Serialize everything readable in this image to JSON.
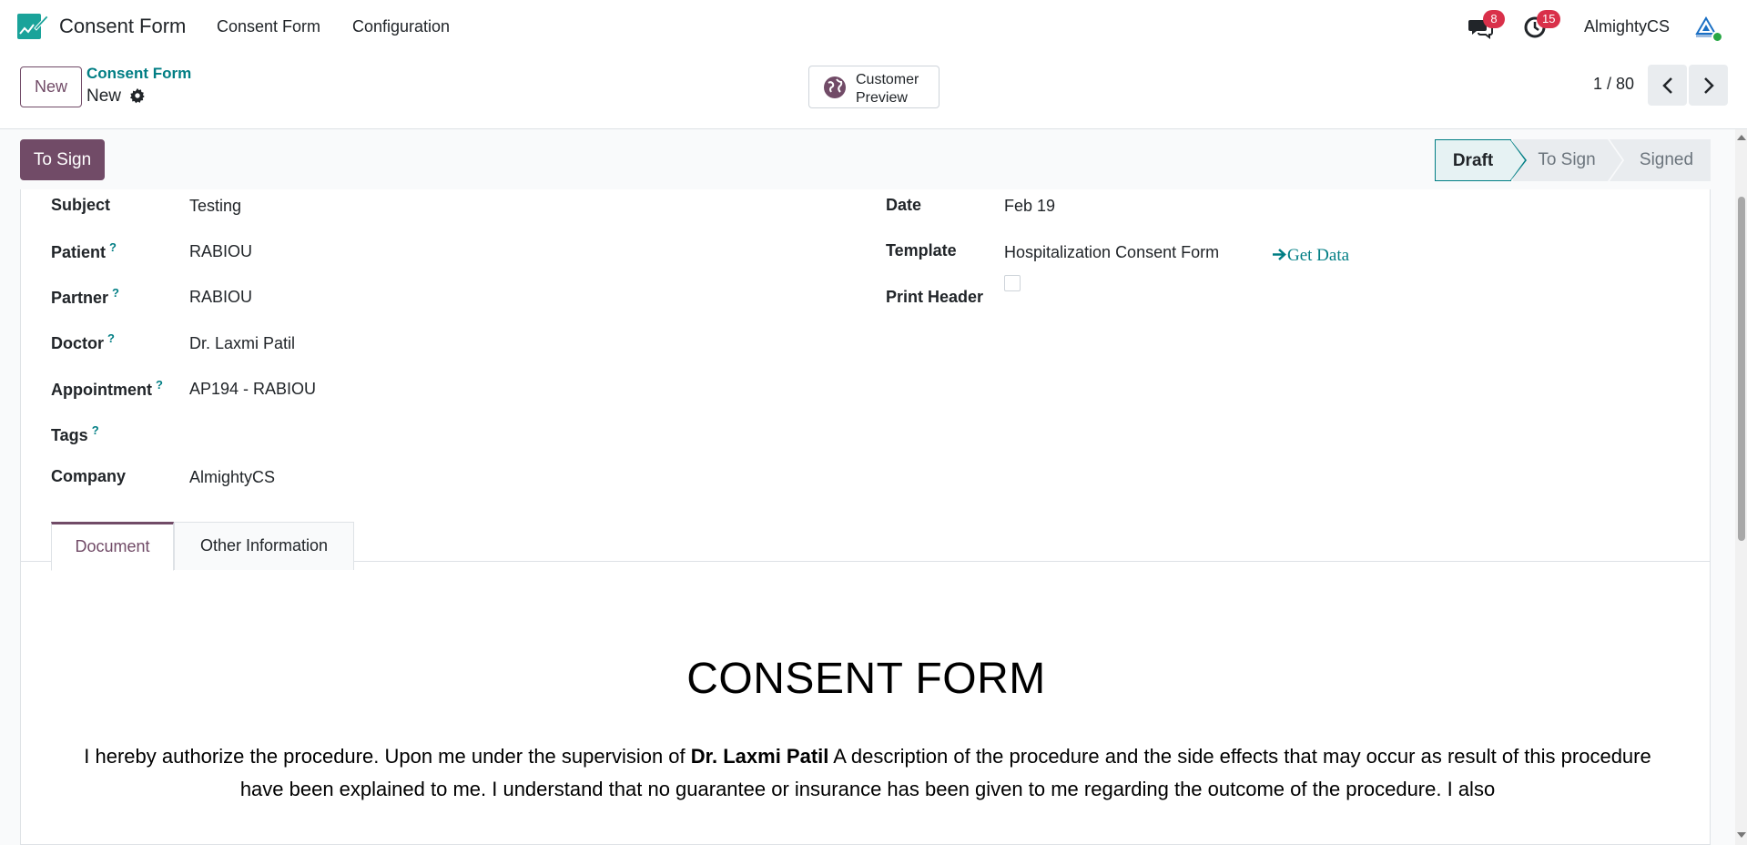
{
  "navbar": {
    "app_title": "Consent Form",
    "menu": [
      "Consent Form",
      "Configuration"
    ],
    "messages_count": "8",
    "activities_count": "15",
    "user_name": "AlmightyCS"
  },
  "control": {
    "new_label": "New",
    "breadcrumb_parent": "Consent Form",
    "breadcrumb_current": "New",
    "customer_preview_label": "Customer Preview",
    "pager": "1 / 80"
  },
  "statusbar": {
    "action_button": "To Sign",
    "stages": [
      "Draft",
      "To Sign",
      "Signed"
    ],
    "active_stage": "Draft"
  },
  "form": {
    "left": [
      {
        "label": "Subject",
        "value": "Testing",
        "help": ""
      },
      {
        "label": "Patient",
        "value": "RABIOU",
        "help": "?"
      },
      {
        "label": "Partner",
        "value": "RABIOU",
        "help": "?"
      },
      {
        "label": "Doctor",
        "value": "Dr. Laxmi Patil",
        "help": "?"
      },
      {
        "label": "Appointment",
        "value": "AP194 - RABIOU",
        "help": "?"
      },
      {
        "label": "Tags",
        "value": "",
        "help": "?"
      },
      {
        "label": "Company",
        "value": "AlmightyCS",
        "help": ""
      }
    ],
    "right": [
      {
        "label": "Date",
        "value": "Feb 19"
      },
      {
        "label": "Template",
        "value": "Hospitalization Consent Form"
      },
      {
        "label": "Print Header",
        "value": ""
      }
    ],
    "get_data_label": "Get Data",
    "print_header_checked": false
  },
  "tabs": [
    "Document",
    "Other Information"
  ],
  "document": {
    "title": "CONSENT FORM",
    "para_before": "I hereby authorize the procedure. Upon me under the supervision of ",
    "para_doctor": "Dr. Laxmi Patil",
    "para_after": " A description of the procedure and the side effects that may occur as result of this procedure have been explained to me. I understand that no guarantee or insurance has been given to me regarding the outcome of the procedure. I also"
  },
  "colors": {
    "brand": "#714b67",
    "accent": "#017e84",
    "badge": "#d9304a"
  }
}
